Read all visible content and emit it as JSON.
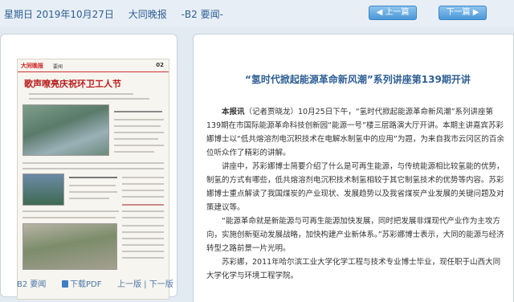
{
  "header": {
    "date": "星期日 2019年10月27日",
    "paper": "大同晚报",
    "page": "-B2 要闻-",
    "prev_label": "上一篇",
    "next_label": "下一篇"
  },
  "thumbnail": {
    "logo": "大同晚报",
    "section": "要闻",
    "page_number": "02",
    "headline": "歌声嘹亮庆祝环卫工人节"
  },
  "left_footer": {
    "page_label": "B2 要闻",
    "download_label": "下载PDF",
    "page_nav": "上一版 | 下一版"
  },
  "article": {
    "title": "“氢时代掀起能源革命新风潮”系列讲座第139期开讲",
    "lead_bold": "本报讯",
    "paragraph_1": "（记者贾晓龙）10月25日下午，“氢时代掀起能源革命新风潮”系列讲座第139期在市国际能源革命科技创新园“能源一号”楼三层路演大厅开讲。本期主讲嘉宾苏彩娜博士以“低共熔溶剂电沉积技术在电解水制氢中的应用”为题，为来自我市云冈区的百余位听众作了精彩的讲解。",
    "paragraph_2": "讲座中，苏彩娜博士简要介绍了什么是可再生能源，与传统能源相比较氢能的优势，制氢的方式有哪些，低共熔溶剂电沉积技术制氢相较于其它制氢技术的优势等内容。苏彩娜博士重点解读了我国煤炭的产业现状、发展趋势以及我省煤炭产业发展的关键问题及对策建议等。",
    "paragraph_3": "“能源革命就是新能源与可再生能源加快发展，同时把发展非煤现代产业作为主攻方向，实施创新驱动发展战略，加快构建产业新体系。”苏彩娜博士表示，大同的能源与经济转型之路前景一片光明。",
    "paragraph_4": "苏彩娜，2011年哈尔滨工业大学化学工程与技术专业博士毕业，现任职于山西大同大学化学与环境工程学院。"
  }
}
